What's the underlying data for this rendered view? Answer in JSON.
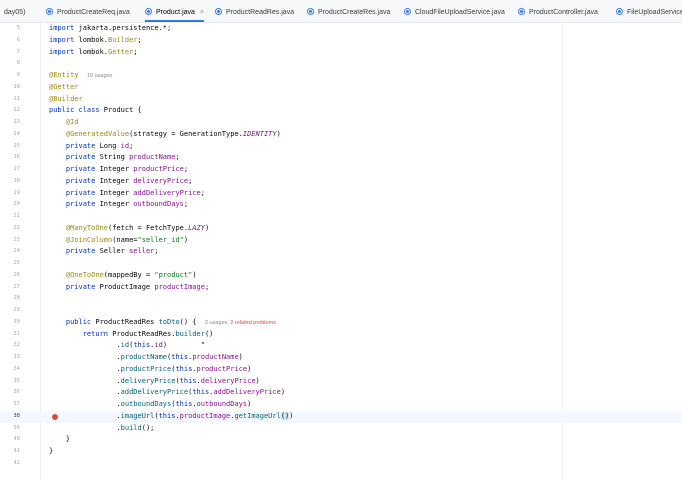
{
  "tabs": [
    {
      "label": "day05)",
      "icon": ""
    },
    {
      "label": "ProductCreateReq.java",
      "icon": "class-icon"
    },
    {
      "label": "Product.java",
      "icon": "class-icon",
      "active": true,
      "close": "×"
    },
    {
      "label": "ProductReadRes.java",
      "icon": "class-icon"
    },
    {
      "label": "ProductCreateRes.java",
      "icon": "class-icon"
    },
    {
      "label": "CloudFileUploadService.java",
      "icon": "class-icon"
    },
    {
      "label": "ProductController.java",
      "icon": "class-icon"
    },
    {
      "label": "FileUploadService.ja",
      "icon": "class-icon"
    }
  ],
  "lines": [
    {
      "n": "5",
      "t": [
        [
          "kw",
          "import "
        ],
        [
          "",
          "jakarta.persistence.*;"
        ]
      ]
    },
    {
      "n": "6",
      "t": [
        [
          "kw",
          "import "
        ],
        [
          "",
          "lombok."
        ],
        [
          "ann",
          "Builder"
        ],
        [
          "",
          ";"
        ]
      ]
    },
    {
      "n": "7",
      "t": [
        [
          "kw",
          "import "
        ],
        [
          "",
          "lombok."
        ],
        [
          "ann",
          "Getter"
        ],
        [
          "",
          ";"
        ]
      ]
    },
    {
      "n": "8",
      "t": []
    },
    {
      "n": "9",
      "t": [
        [
          "ann",
          "@Entity"
        ],
        [
          "",
          "  "
        ],
        [
          "hint",
          "18 usages"
        ]
      ]
    },
    {
      "n": "10",
      "t": [
        [
          "ann",
          "@Getter"
        ]
      ]
    },
    {
      "n": "11",
      "t": [
        [
          "ann",
          "@Builder"
        ]
      ]
    },
    {
      "n": "12",
      "t": [
        [
          "kw",
          "public class "
        ],
        [
          "",
          "Product {"
        ]
      ]
    },
    {
      "n": "13",
      "t": [
        [
          "",
          "    "
        ],
        [
          "ann",
          "@Id"
        ]
      ]
    },
    {
      "n": "14",
      "t": [
        [
          "",
          "    "
        ],
        [
          "ann",
          "@GeneratedValue"
        ],
        [
          "",
          "(strategy = GenerationType."
        ],
        [
          "cst",
          "IDENTITY"
        ],
        [
          "",
          ")"
        ]
      ]
    },
    {
      "n": "15",
      "t": [
        [
          "",
          "    "
        ],
        [
          "kw",
          "private "
        ],
        [
          "",
          "Long "
        ],
        [
          "fld",
          "id"
        ],
        [
          "",
          ";"
        ]
      ]
    },
    {
      "n": "16",
      "t": [
        [
          "",
          "    "
        ],
        [
          "kw",
          "private "
        ],
        [
          "",
          "String "
        ],
        [
          "fld",
          "productName"
        ],
        [
          "",
          ";"
        ]
      ]
    },
    {
      "n": "17",
      "t": [
        [
          "",
          "    "
        ],
        [
          "kw",
          "private "
        ],
        [
          "",
          "Integer "
        ],
        [
          "fld",
          "productPrice"
        ],
        [
          "",
          ";"
        ]
      ]
    },
    {
      "n": "18",
      "t": [
        [
          "",
          "    "
        ],
        [
          "kw",
          "private "
        ],
        [
          "",
          "Integer "
        ],
        [
          "fld",
          "deliveryPrice"
        ],
        [
          "",
          ";"
        ]
      ]
    },
    {
      "n": "19",
      "t": [
        [
          "",
          "    "
        ],
        [
          "kw",
          "private "
        ],
        [
          "",
          "Integer "
        ],
        [
          "fld",
          "addDeliveryPrice"
        ],
        [
          "",
          ";"
        ]
      ]
    },
    {
      "n": "20",
      "t": [
        [
          "",
          "    "
        ],
        [
          "kw",
          "private "
        ],
        [
          "",
          "Integer "
        ],
        [
          "fld",
          "outboundDays"
        ],
        [
          "",
          ";"
        ]
      ]
    },
    {
      "n": "21",
      "t": []
    },
    {
      "n": "22",
      "t": [
        [
          "",
          "    "
        ],
        [
          "ann",
          "@ManyToOne"
        ],
        [
          "",
          "(fetch = FetchType."
        ],
        [
          "cst",
          "LAZY"
        ],
        [
          "",
          ")"
        ]
      ]
    },
    {
      "n": "23",
      "t": [
        [
          "",
          "    "
        ],
        [
          "ann",
          "@JoinColumn"
        ],
        [
          "",
          "(name="
        ],
        [
          "str",
          "\"seller_id\""
        ],
        [
          "",
          ")"
        ]
      ]
    },
    {
      "n": "24",
      "t": [
        [
          "",
          "    "
        ],
        [
          "kw",
          "private "
        ],
        [
          "",
          "Seller "
        ],
        [
          "fld",
          "seller"
        ],
        [
          "",
          ";"
        ]
      ]
    },
    {
      "n": "25",
      "t": []
    },
    {
      "n": "26",
      "t": [
        [
          "",
          "    "
        ],
        [
          "ann",
          "@OneToOne"
        ],
        [
          "",
          "(mappedBy = "
        ],
        [
          "str",
          "\"product\""
        ],
        [
          "",
          ")"
        ]
      ]
    },
    {
      "n": "27",
      "t": [
        [
          "",
          "    "
        ],
        [
          "kw",
          "private "
        ],
        [
          "",
          "ProductImage "
        ],
        [
          "fld",
          "productImage"
        ],
        [
          "",
          ";"
        ]
      ]
    },
    {
      "n": "28",
      "t": []
    },
    {
      "n": "29",
      "t": []
    },
    {
      "n": "30",
      "t": [
        [
          "",
          "    "
        ],
        [
          "kw",
          "public "
        ],
        [
          "",
          "ProductReadRes "
        ],
        [
          "mth",
          "toDto"
        ],
        [
          "",
          "() {  "
        ],
        [
          "hint",
          "2 usages  "
        ],
        [
          "prob",
          "2 related problems"
        ]
      ]
    },
    {
      "n": "31",
      "t": [
        [
          "",
          "        "
        ],
        [
          "kw",
          "return "
        ],
        [
          "",
          "ProductReadRes."
        ],
        [
          "mth",
          "builder"
        ],
        [
          "",
          "()"
        ]
      ]
    },
    {
      "n": "32",
      "t": [
        [
          "",
          "                ."
        ],
        [
          "mth",
          "id"
        ],
        [
          "",
          "("
        ],
        [
          "kw",
          "this"
        ],
        [
          "",
          "."
        ],
        [
          "fld",
          "id"
        ],
        [
          "",
          ")        \""
        ]
      ]
    },
    {
      "n": "33",
      "t": [
        [
          "",
          "                ."
        ],
        [
          "mth",
          "productName"
        ],
        [
          "",
          "("
        ],
        [
          "kw",
          "this"
        ],
        [
          "",
          "."
        ],
        [
          "fld",
          "productName"
        ],
        [
          "",
          ")"
        ]
      ]
    },
    {
      "n": "34",
      "t": [
        [
          "",
          "                ."
        ],
        [
          "mth",
          "productPrice"
        ],
        [
          "",
          "("
        ],
        [
          "kw",
          "this"
        ],
        [
          "",
          "."
        ],
        [
          "fld",
          "productPrice"
        ],
        [
          "",
          ")"
        ]
      ]
    },
    {
      "n": "35",
      "t": [
        [
          "",
          "                ."
        ],
        [
          "mth",
          "deliveryPrice"
        ],
        [
          "",
          "("
        ],
        [
          "kw",
          "this"
        ],
        [
          "",
          "."
        ],
        [
          "fld",
          "deliveryPrice"
        ],
        [
          "",
          ")"
        ]
      ]
    },
    {
      "n": "36",
      "t": [
        [
          "",
          "                ."
        ],
        [
          "mth",
          "addDeliveryPrice"
        ],
        [
          "",
          "("
        ],
        [
          "kw",
          "this"
        ],
        [
          "",
          "."
        ],
        [
          "fld",
          "addDeliveryPrice"
        ],
        [
          "",
          ")"
        ]
      ]
    },
    {
      "n": "37",
      "t": [
        [
          "",
          "                ."
        ],
        [
          "mth",
          "outboundDays"
        ],
        [
          "",
          "("
        ],
        [
          "kw",
          "this"
        ],
        [
          "",
          "."
        ],
        [
          "fld",
          "outboundDays"
        ],
        [
          "",
          ")"
        ]
      ]
    },
    {
      "n": "38",
      "t": [
        [
          "",
          "                ."
        ],
        [
          "mth",
          "imageUrl"
        ],
        [
          "",
          "("
        ],
        [
          "kw",
          "this"
        ],
        [
          "",
          "."
        ],
        [
          "fld",
          "productImage"
        ],
        [
          "",
          "."
        ],
        [
          "mth",
          "getImageUrl"
        ],
        [
          "caretbox",
          "()"
        ],
        [
          "",
          ")"
        ]
      ],
      "current": true
    },
    {
      "n": "39",
      "t": [
        [
          "",
          "                ."
        ],
        [
          "mth",
          "build"
        ],
        [
          "",
          "();"
        ]
      ]
    },
    {
      "n": "40",
      "t": [
        [
          "",
          "    }"
        ]
      ]
    },
    {
      "n": "41",
      "t": [
        [
          "",
          "}"
        ]
      ]
    },
    {
      "n": "42",
      "t": []
    }
  ],
  "colors": {
    "keyword": "#0033b3",
    "annotation": "#9e880d",
    "field": "#871094",
    "string": "#067d17",
    "method": "#00627a",
    "error": "#e0483e",
    "active_tab": "#3574f0"
  }
}
